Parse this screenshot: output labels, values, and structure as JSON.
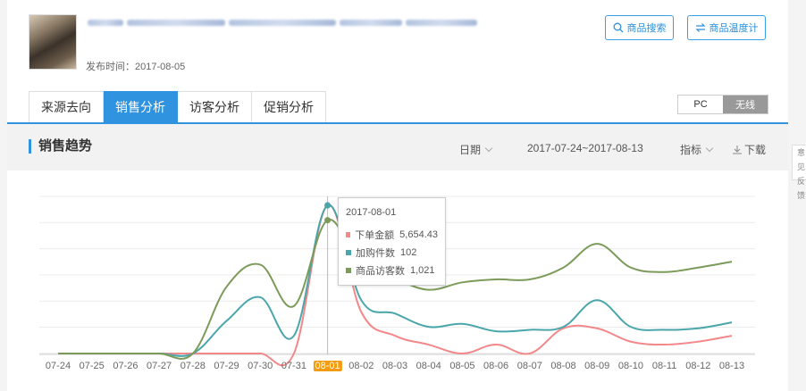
{
  "header": {
    "publish_label": "发布时间：2017-08-05",
    "buttons": {
      "search": "商品搜索",
      "temperature": "商品温度计"
    }
  },
  "tabs": [
    "来源去向",
    "销售分析",
    "访客分析",
    "促销分析"
  ],
  "active_tab": 1,
  "device_toggle": {
    "pc": "PC",
    "wireless": "无线",
    "selected": "无线"
  },
  "trend": {
    "title": "销售趋势",
    "date_label": "日期",
    "date_range": "2017-07-24~2017-08-13",
    "metric_label": "指标",
    "download_label": "下载"
  },
  "side_strip": {
    "text": "意见反馈"
  },
  "tooltip": {
    "date": "2017-08-01",
    "rows": [
      {
        "label": "下单金额",
        "value": "5,654.43"
      },
      {
        "label": "加购件数",
        "value": "102"
      },
      {
        "label": "商品访客数",
        "value": "1,021"
      }
    ]
  },
  "colors": {
    "accent": "#2f93e0",
    "highlight": "#f39c12",
    "series_order": "#f2888a",
    "series_cart": "#4aa6aa",
    "series_visitor": "#7c9b5a"
  },
  "chart_data": {
    "type": "line",
    "x": [
      "07-24",
      "07-25",
      "07-26",
      "07-27",
      "07-28",
      "07-29",
      "07-30",
      "07-31",
      "08-01",
      "08-02",
      "08-03",
      "08-04",
      "08-05",
      "08-06",
      "08-07",
      "08-08",
      "08-09",
      "08-10",
      "08-11",
      "08-12",
      "08-13"
    ],
    "highlighted_x": "08-01",
    "series": [
      {
        "name": "下单金额",
        "color": "#f2888a",
        "relative_values": [
          0,
          0,
          0,
          0,
          0,
          0,
          0,
          0,
          1.0,
          0.28,
          0.12,
          0.06,
          0.0,
          0.06,
          0.0,
          0.17,
          0.17,
          0.08,
          0.06,
          0.08,
          0.12
        ]
      },
      {
        "name": "加购件数",
        "color": "#4aa6aa",
        "relative_values": [
          0,
          0,
          0,
          0,
          0,
          0.22,
          0.38,
          0.12,
          1.0,
          0.36,
          0.27,
          0.18,
          0.2,
          0.15,
          0.16,
          0.18,
          0.36,
          0.18,
          0.16,
          0.17,
          0.21
        ]
      },
      {
        "name": "商品访客数",
        "color": "#7c9b5a",
        "relative_values": [
          0,
          0,
          0,
          0,
          0,
          0.45,
          0.6,
          0.32,
          0.9,
          0.56,
          0.5,
          0.43,
          0.48,
          0.5,
          0.5,
          0.58,
          0.74,
          0.58,
          0.55,
          0.58,
          0.62
        ]
      }
    ],
    "grid": true
  }
}
